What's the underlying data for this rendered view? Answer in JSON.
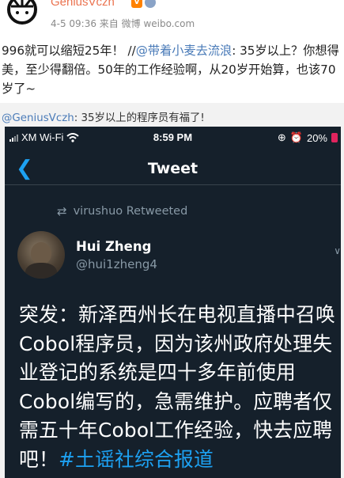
{
  "weibo": {
    "username": "GeniusVczh",
    "meta": "4-5 09:36  来自 微博 weibo.com",
    "post_text_before": "996就可以缩短25年！ //",
    "post_mention": "@带着小麦去流浪",
    "post_text_after": ": 35岁以上？你想得美，至少得翻倍。50年的工作经验啊，从20岁开始算，也该70岁了~",
    "repost_user": "@GeniusVczh",
    "repost_text": ": 35岁以上的程序员有福了!"
  },
  "phone": {
    "carrier": "XM Wi-Fi",
    "time": "8:59 PM",
    "battery": "20%",
    "nav_title": "Tweet",
    "retweeted_by": "virushuo Retweeted",
    "author_name": "Hui Zheng",
    "author_handle": "@hui1zheng4",
    "tweet_text": "突发：新泽西州长在电视直播中召唤Cobol程序员，因为该州政府处理失业登记的系统是四十多年前使用Cobol编写的，急需维护。应聘者仅需五十年Cobol工作经验，快去应聘吧！",
    "hashtag": "#土谣社综合报道"
  },
  "colors": {
    "weibo_orange": "#eb7350",
    "weibo_link": "#4a7bb8",
    "twitter_bg": "#15202b",
    "twitter_blue": "#1da1f2"
  }
}
